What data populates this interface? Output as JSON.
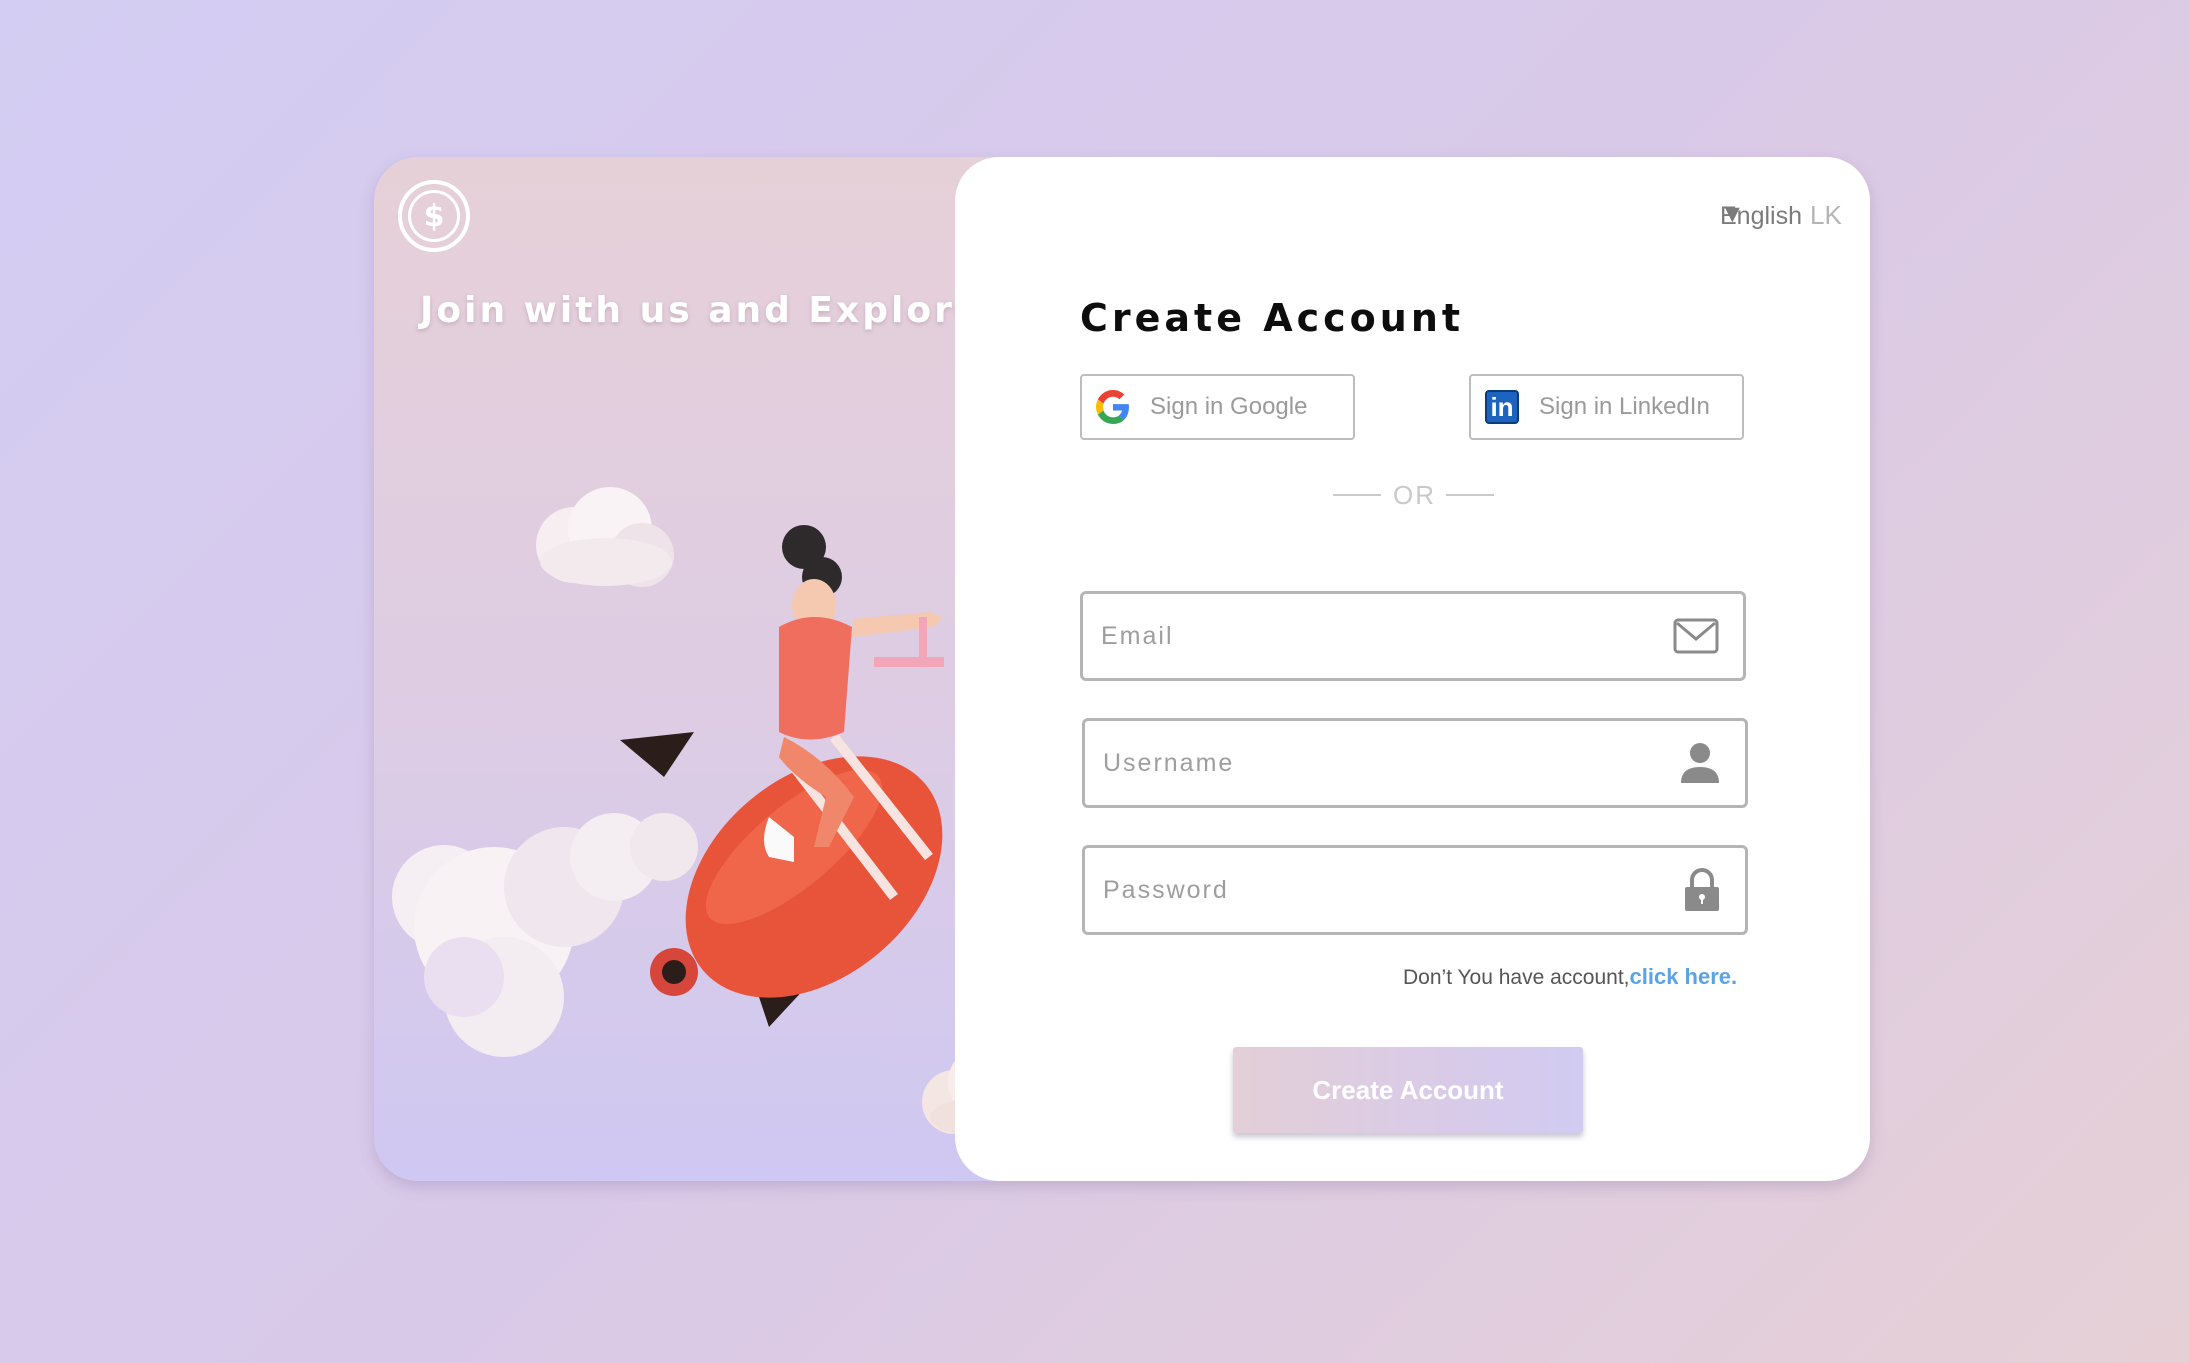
{
  "brand": {
    "logo_glyph": "$"
  },
  "hero": {
    "tagline": "Join with us and Explore"
  },
  "language": {
    "label": "English",
    "code": "LK"
  },
  "form": {
    "title": "Create Account",
    "google_label": "Sign in Google",
    "linkedin_label": "Sign in LinkedIn",
    "linkedin_glyph": "in",
    "separator": "OR",
    "email_placeholder": "Email",
    "username_placeholder": "Username",
    "password_placeholder": "Password",
    "account_prompt": "Don’t You have account,",
    "account_link": "click here.",
    "submit_label": "Create Account"
  },
  "colors": {
    "accent_link": "#5ba3e6",
    "linkedin_blue": "#1e64be",
    "gradient_pink": "#e6d0d8",
    "gradient_lavender": "#cfc8f2"
  }
}
